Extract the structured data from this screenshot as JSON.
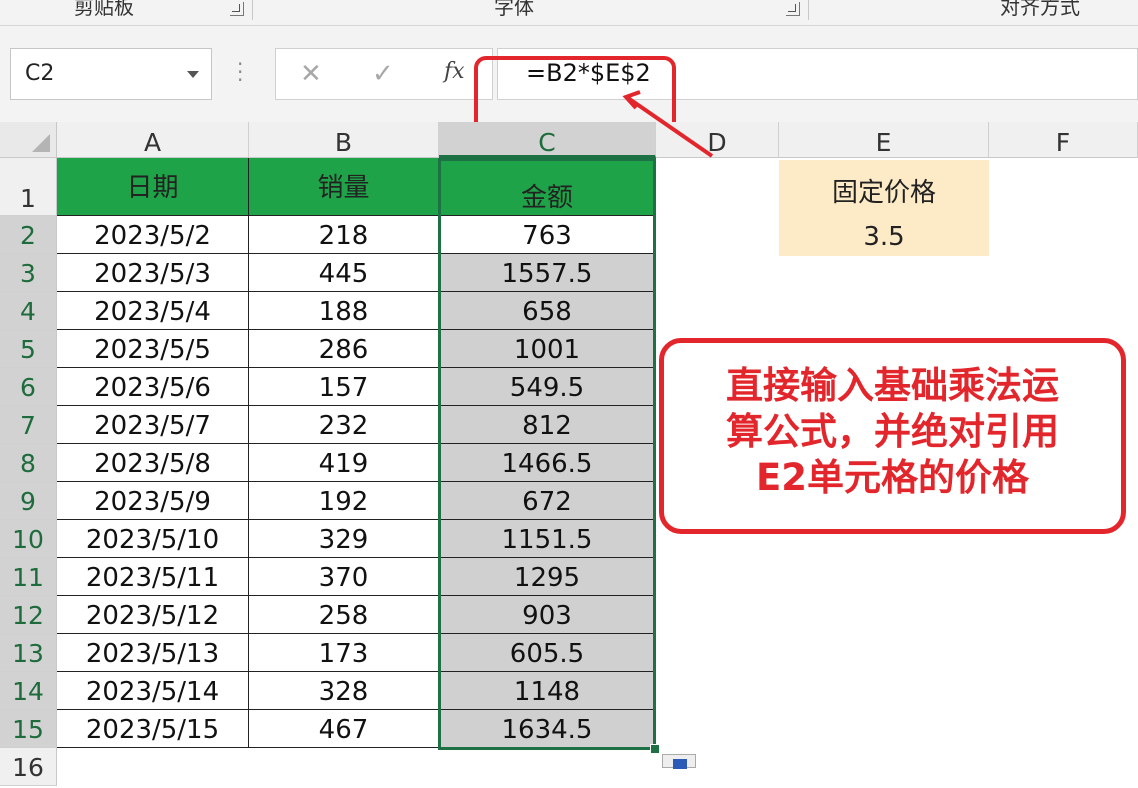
{
  "ribbon": {
    "groups": [
      "剪贴板",
      "字体",
      "对齐方式"
    ]
  },
  "formula_bar": {
    "name_box": "C2",
    "formula": "=B2*$E$2",
    "cancel_glyph": "✕",
    "enter_glyph": "✓",
    "fx_label": "fx"
  },
  "columns": [
    "A",
    "B",
    "C",
    "D",
    "E",
    "F"
  ],
  "row_numbers": [
    "1",
    "2",
    "3",
    "4",
    "5",
    "6",
    "7",
    "8",
    "9",
    "10",
    "11",
    "12",
    "13",
    "14",
    "15",
    "16"
  ],
  "table": {
    "headers": [
      "日期",
      "销量",
      "金额"
    ],
    "rows": [
      [
        "2023/5/2",
        "218",
        "763"
      ],
      [
        "2023/5/3",
        "445",
        "1557.5"
      ],
      [
        "2023/5/4",
        "188",
        "658"
      ],
      [
        "2023/5/5",
        "286",
        "1001"
      ],
      [
        "2023/5/6",
        "157",
        "549.5"
      ],
      [
        "2023/5/7",
        "232",
        "812"
      ],
      [
        "2023/5/8",
        "419",
        "1466.5"
      ],
      [
        "2023/5/9",
        "192",
        "672"
      ],
      [
        "2023/5/10",
        "329",
        "1151.5"
      ],
      [
        "2023/5/11",
        "370",
        "1295"
      ],
      [
        "2023/5/12",
        "258",
        "903"
      ],
      [
        "2023/5/13",
        "173",
        "605.5"
      ],
      [
        "2023/5/14",
        "328",
        "1148"
      ],
      [
        "2023/5/15",
        "467",
        "1634.5"
      ]
    ]
  },
  "fixed_price": {
    "label": "固定价格",
    "value": "3.5"
  },
  "callout": {
    "lines": [
      "直接输入基础乘法运",
      "算公式，并绝对引用",
      "E2单元格的价格"
    ]
  },
  "colors": {
    "header_green": "#1fa348",
    "selection_green": "#1e7145",
    "callout_red": "#e2262b",
    "fixed_fill": "#fdeac6"
  }
}
